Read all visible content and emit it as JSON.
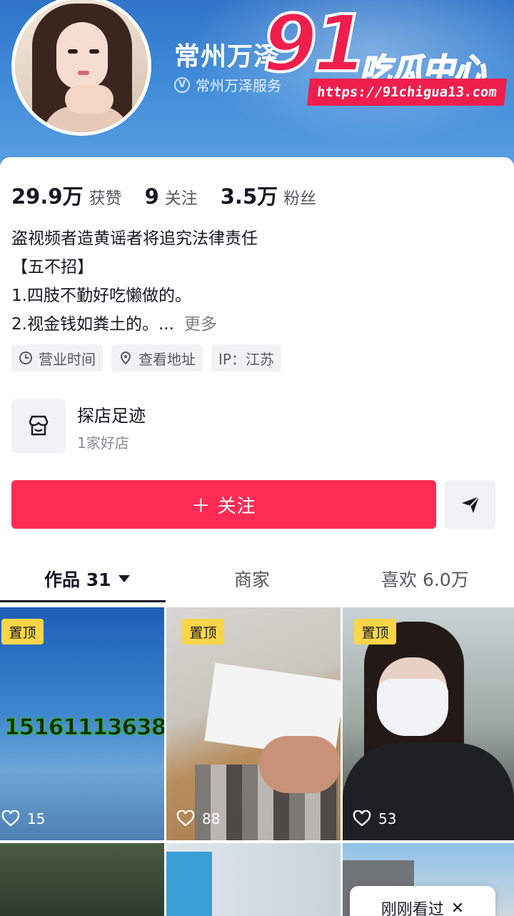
{
  "header": {
    "profile_name": "常州万泽",
    "verified_label": "常州万泽服务",
    "watermark": {
      "number": "91",
      "text": "吃瓜中心",
      "url": "https://91chigua13.com"
    }
  },
  "stats": [
    {
      "value": "29.9万",
      "label": "获赞"
    },
    {
      "value": "9",
      "label": "关注"
    },
    {
      "value": "3.5万",
      "label": "粉丝"
    }
  ],
  "bio": {
    "lines": [
      "盗视频者造黄谣者将追究法律责任",
      "【五不招】",
      "1.四肢不勤好吃懒做的。",
      "2.视金钱如粪土的。..."
    ],
    "more_label": "更多"
  },
  "chips": [
    {
      "icon": "clock-icon",
      "label": "营业时间"
    },
    {
      "icon": "location-pin-icon",
      "label": "查看地址"
    },
    {
      "icon": "",
      "label": "IP：江苏"
    }
  ],
  "store": {
    "title": "探店足迹",
    "subtitle": "1家好店"
  },
  "actions": {
    "follow_label": "＋ 关注",
    "share_icon": "send-icon"
  },
  "tabs": [
    {
      "label": "作品 31",
      "active": true
    },
    {
      "label": "商家",
      "active": false
    },
    {
      "label": "喜欢 6.0万",
      "active": false
    }
  ],
  "videos": [
    {
      "pinned_label": "置顶",
      "likes": "15",
      "overlay_text": "15161113638"
    },
    {
      "pinned_label": "置顶",
      "likes": "88"
    },
    {
      "pinned_label": "置顶",
      "likes": "53"
    }
  ],
  "toast": {
    "label": "刚刚看过",
    "close_icon": "close-icon"
  },
  "colors": {
    "accent": "#fe2c55",
    "pin_badge": "#f9d548",
    "header_blue": "#3f8ad8"
  }
}
